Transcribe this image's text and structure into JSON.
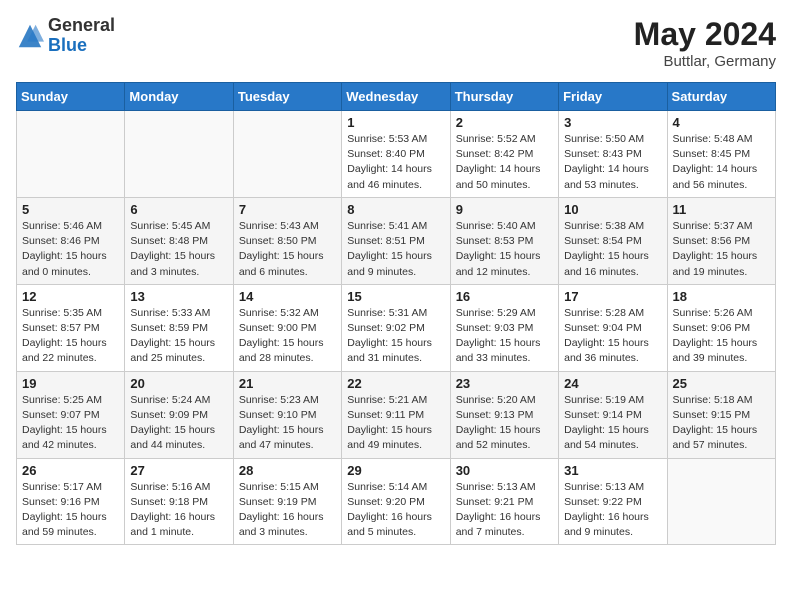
{
  "header": {
    "logo_general": "General",
    "logo_blue": "Blue",
    "title": "May 2024",
    "location": "Buttlar, Germany"
  },
  "weekdays": [
    "Sunday",
    "Monday",
    "Tuesday",
    "Wednesday",
    "Thursday",
    "Friday",
    "Saturday"
  ],
  "weeks": [
    [
      {
        "day": "",
        "info": ""
      },
      {
        "day": "",
        "info": ""
      },
      {
        "day": "",
        "info": ""
      },
      {
        "day": "1",
        "info": "Sunrise: 5:53 AM\nSunset: 8:40 PM\nDaylight: 14 hours\nand 46 minutes."
      },
      {
        "day": "2",
        "info": "Sunrise: 5:52 AM\nSunset: 8:42 PM\nDaylight: 14 hours\nand 50 minutes."
      },
      {
        "day": "3",
        "info": "Sunrise: 5:50 AM\nSunset: 8:43 PM\nDaylight: 14 hours\nand 53 minutes."
      },
      {
        "day": "4",
        "info": "Sunrise: 5:48 AM\nSunset: 8:45 PM\nDaylight: 14 hours\nand 56 minutes."
      }
    ],
    [
      {
        "day": "5",
        "info": "Sunrise: 5:46 AM\nSunset: 8:46 PM\nDaylight: 15 hours\nand 0 minutes."
      },
      {
        "day": "6",
        "info": "Sunrise: 5:45 AM\nSunset: 8:48 PM\nDaylight: 15 hours\nand 3 minutes."
      },
      {
        "day": "7",
        "info": "Sunrise: 5:43 AM\nSunset: 8:50 PM\nDaylight: 15 hours\nand 6 minutes."
      },
      {
        "day": "8",
        "info": "Sunrise: 5:41 AM\nSunset: 8:51 PM\nDaylight: 15 hours\nand 9 minutes."
      },
      {
        "day": "9",
        "info": "Sunrise: 5:40 AM\nSunset: 8:53 PM\nDaylight: 15 hours\nand 12 minutes."
      },
      {
        "day": "10",
        "info": "Sunrise: 5:38 AM\nSunset: 8:54 PM\nDaylight: 15 hours\nand 16 minutes."
      },
      {
        "day": "11",
        "info": "Sunrise: 5:37 AM\nSunset: 8:56 PM\nDaylight: 15 hours\nand 19 minutes."
      }
    ],
    [
      {
        "day": "12",
        "info": "Sunrise: 5:35 AM\nSunset: 8:57 PM\nDaylight: 15 hours\nand 22 minutes."
      },
      {
        "day": "13",
        "info": "Sunrise: 5:33 AM\nSunset: 8:59 PM\nDaylight: 15 hours\nand 25 minutes."
      },
      {
        "day": "14",
        "info": "Sunrise: 5:32 AM\nSunset: 9:00 PM\nDaylight: 15 hours\nand 28 minutes."
      },
      {
        "day": "15",
        "info": "Sunrise: 5:31 AM\nSunset: 9:02 PM\nDaylight: 15 hours\nand 31 minutes."
      },
      {
        "day": "16",
        "info": "Sunrise: 5:29 AM\nSunset: 9:03 PM\nDaylight: 15 hours\nand 33 minutes."
      },
      {
        "day": "17",
        "info": "Sunrise: 5:28 AM\nSunset: 9:04 PM\nDaylight: 15 hours\nand 36 minutes."
      },
      {
        "day": "18",
        "info": "Sunrise: 5:26 AM\nSunset: 9:06 PM\nDaylight: 15 hours\nand 39 minutes."
      }
    ],
    [
      {
        "day": "19",
        "info": "Sunrise: 5:25 AM\nSunset: 9:07 PM\nDaylight: 15 hours\nand 42 minutes."
      },
      {
        "day": "20",
        "info": "Sunrise: 5:24 AM\nSunset: 9:09 PM\nDaylight: 15 hours\nand 44 minutes."
      },
      {
        "day": "21",
        "info": "Sunrise: 5:23 AM\nSunset: 9:10 PM\nDaylight: 15 hours\nand 47 minutes."
      },
      {
        "day": "22",
        "info": "Sunrise: 5:21 AM\nSunset: 9:11 PM\nDaylight: 15 hours\nand 49 minutes."
      },
      {
        "day": "23",
        "info": "Sunrise: 5:20 AM\nSunset: 9:13 PM\nDaylight: 15 hours\nand 52 minutes."
      },
      {
        "day": "24",
        "info": "Sunrise: 5:19 AM\nSunset: 9:14 PM\nDaylight: 15 hours\nand 54 minutes."
      },
      {
        "day": "25",
        "info": "Sunrise: 5:18 AM\nSunset: 9:15 PM\nDaylight: 15 hours\nand 57 minutes."
      }
    ],
    [
      {
        "day": "26",
        "info": "Sunrise: 5:17 AM\nSunset: 9:16 PM\nDaylight: 15 hours\nand 59 minutes."
      },
      {
        "day": "27",
        "info": "Sunrise: 5:16 AM\nSunset: 9:18 PM\nDaylight: 16 hours\nand 1 minute."
      },
      {
        "day": "28",
        "info": "Sunrise: 5:15 AM\nSunset: 9:19 PM\nDaylight: 16 hours\nand 3 minutes."
      },
      {
        "day": "29",
        "info": "Sunrise: 5:14 AM\nSunset: 9:20 PM\nDaylight: 16 hours\nand 5 minutes."
      },
      {
        "day": "30",
        "info": "Sunrise: 5:13 AM\nSunset: 9:21 PM\nDaylight: 16 hours\nand 7 minutes."
      },
      {
        "day": "31",
        "info": "Sunrise: 5:13 AM\nSunset: 9:22 PM\nDaylight: 16 hours\nand 9 minutes."
      },
      {
        "day": "",
        "info": ""
      }
    ]
  ]
}
